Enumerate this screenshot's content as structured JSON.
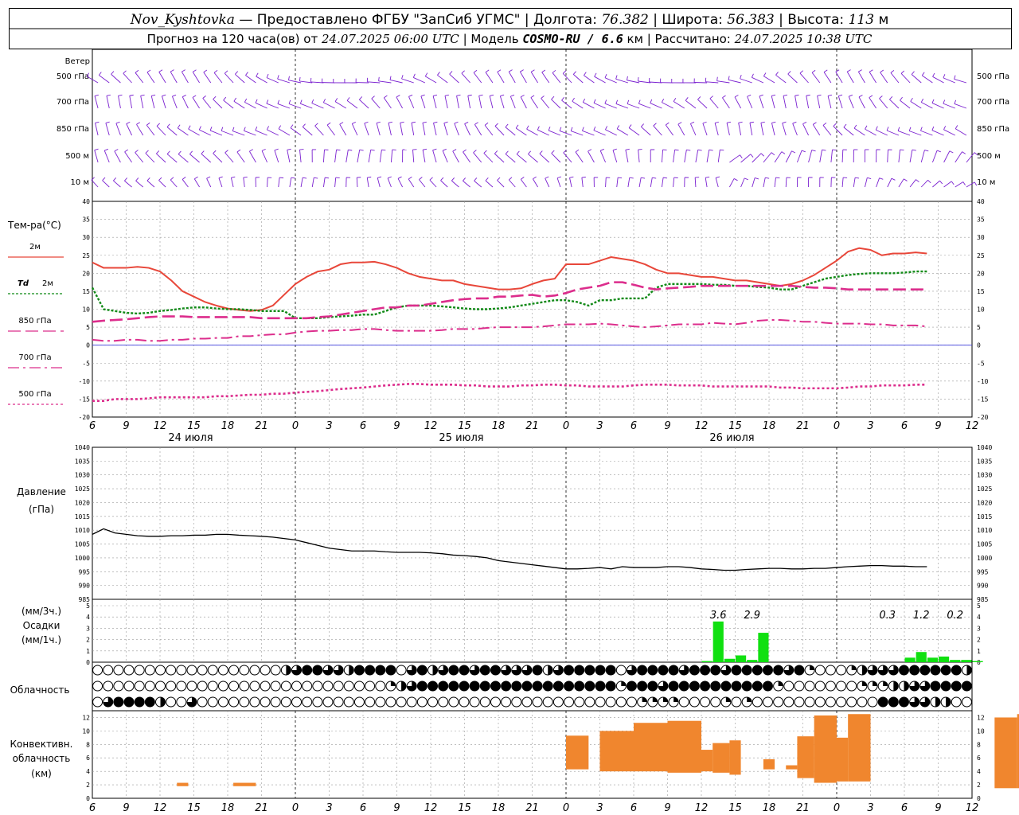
{
  "header": {
    "station": "Nov_Kyshtovka",
    "provider": " — Предоставлено ФГБУ \"ЗапСиб УГМС\"",
    "lon_label": "Долгота:",
    "lon_value": "76.382",
    "lat_label": "Широта:",
    "lat_value": "56.383",
    "alt_label": "Высота:",
    "alt_value": "113",
    "alt_unit": "м",
    "forecast_prefix": "Прогноз на 120 часа(ов) от",
    "forecast_date": "24.07.2025 06:00 UTC",
    "model_label": "Модель",
    "model_name": "COSMO-RU / 6.6",
    "model_unit": "км",
    "calc_label": "Рассчитано:",
    "calc_date": "24.07.2025 10:38 UTC"
  },
  "colors": {
    "wind": "#7a20d0",
    "t2m": "#e8473a",
    "td": "#128a18",
    "t850": "#dc2d8c",
    "t700": "#dc2d8c",
    "t500": "#dc2d8c",
    "zero": "#3a3adc",
    "precip": "#10e010",
    "conv": "#f0862e"
  },
  "chart_data": {
    "type": "line",
    "x_hours": {
      "start": "2025-07-24 06:00 UTC",
      "end": "2025-07-26 12:00 UTC",
      "tick_labels": [
        "6",
        "9",
        "12",
        "15",
        "18",
        "21",
        "0",
        "3",
        "6",
        "9",
        "12",
        "15",
        "18",
        "21",
        "0",
        "3",
        "6",
        "9",
        "12",
        "15",
        "18",
        "21",
        "0",
        "3",
        "6",
        "9",
        "12"
      ]
    },
    "day_labels": [
      "24 июля",
      "25 июля",
      "26 июля"
    ],
    "wind": {
      "title": "Ветер",
      "levels": [
        "500 гПа",
        "700 гПа",
        "850 гПа",
        "500 м",
        "10  м"
      ]
    },
    "temperature": {
      "title": "Тем-ра(°С)",
      "ylim": [
        -20,
        40
      ],
      "ticks": [
        "-20",
        "-15",
        "-10",
        "-5",
        "0",
        "5",
        "10",
        "15",
        "20",
        "25",
        "30",
        "35",
        "40"
      ],
      "legend": [
        {
          "label": "2м",
          "label_b": ""
        },
        {
          "label": "Td",
          "label_b": "2м"
        },
        {
          "label": "850 гПа",
          "label_b": ""
        },
        {
          "label": "700 гПа",
          "label_b": ""
        },
        {
          "label": "500 гПа",
          "label_b": ""
        }
      ],
      "series": [
        {
          "name": "2м",
          "values": [
            23,
            21.5,
            21.5,
            21.5,
            21.8,
            21.5,
            20.5,
            18,
            15,
            13.5,
            12,
            11,
            10.2,
            9.8,
            9.5,
            9.8,
            11,
            14,
            17,
            19,
            20.5,
            21,
            22.5,
            23,
            23,
            23.2,
            22.5,
            21.5,
            20,
            19,
            18.5,
            18,
            18,
            17,
            16.5,
            16,
            15.5,
            15.5,
            15.8,
            17,
            18,
            18.5,
            22.5,
            22.5,
            22.5,
            23.5,
            24.5,
            24,
            23.5,
            22.5,
            21,
            20,
            20,
            19.5,
            19,
            19,
            18.5,
            18,
            18,
            17.5,
            17,
            16.5,
            17,
            18,
            19.5,
            21.5,
            23.5,
            26,
            27,
            26.5,
            25,
            25.5,
            25.5,
            25.8,
            25.5
          ]
        },
        {
          "name": "Td 2м",
          "values": [
            16,
            10,
            9.5,
            9,
            8.8,
            9,
            9.5,
            9.8,
            10.2,
            10.5,
            10.5,
            10.2,
            10,
            10,
            9.8,
            9.5,
            9.5,
            9.5,
            7.5,
            7.5,
            7.5,
            7.8,
            8,
            8.2,
            8.5,
            8.5,
            9.5,
            10.5,
            11,
            11,
            11,
            10.8,
            10.5,
            10.2,
            10,
            10,
            10.2,
            10.5,
            11,
            11.5,
            12,
            12.5,
            12.5,
            12,
            11,
            12.5,
            12.5,
            13,
            13,
            13,
            16,
            17,
            17,
            17,
            17,
            16.8,
            16.8,
            16.5,
            16.5,
            16.2,
            16,
            15.5,
            15.5,
            16.5,
            17.5,
            18.5,
            19,
            19.5,
            19.8,
            20,
            20,
            20,
            20.2,
            20.5,
            20.5
          ]
        },
        {
          "name": "850 гПа",
          "values": [
            6.5,
            6.8,
            7,
            7.2,
            7.5,
            7.8,
            8,
            8,
            8,
            7.8,
            7.8,
            7.8,
            7.8,
            7.8,
            7.8,
            7.5,
            7.5,
            7.5,
            7.5,
            7.5,
            7.8,
            8,
            8.5,
            9,
            9.5,
            10,
            10.5,
            10.5,
            11,
            11,
            11.5,
            12,
            12.5,
            12.8,
            13,
            13,
            13.5,
            13.5,
            13.8,
            14,
            13.5,
            13.8,
            14.5,
            15.5,
            16,
            16.5,
            17.5,
            17.5,
            16.8,
            16,
            15.5,
            15.8,
            16,
            16.2,
            16.5,
            16.5,
            16.5,
            16.5,
            16.5,
            16.5,
            16.5,
            16.5,
            16.5,
            16.2,
            16,
            16,
            15.8,
            15.5,
            15.5,
            15.5,
            15.5,
            15.5,
            15.5,
            15.5,
            15.5
          ]
        },
        {
          "name": "700 гПа",
          "values": [
            1.5,
            1.2,
            1.2,
            1.5,
            1.5,
            1.2,
            1.2,
            1.5,
            1.5,
            1.8,
            1.8,
            2,
            2,
            2.5,
            2.5,
            2.8,
            3,
            3,
            3.5,
            3.8,
            4,
            4,
            4.2,
            4.2,
            4.5,
            4.5,
            4.2,
            4,
            4,
            4,
            4,
            4.2,
            4.5,
            4.5,
            4.5,
            4.8,
            5,
            5,
            5,
            5,
            5.2,
            5.5,
            5.8,
            5.8,
            5.8,
            6,
            5.8,
            5.5,
            5.2,
            5,
            5.2,
            5.5,
            5.8,
            5.8,
            5.8,
            6.2,
            6,
            5.8,
            6.2,
            6.8,
            7,
            7,
            6.8,
            6.5,
            6.5,
            6.2,
            6,
            6,
            6,
            5.8,
            5.8,
            5.5,
            5.5,
            5.5,
            5.2
          ]
        },
        {
          "name": "500 гПа",
          "values": [
            -15.5,
            -15.5,
            -15,
            -15,
            -15,
            -14.8,
            -14.5,
            -14.5,
            -14.5,
            -14.5,
            -14.5,
            -14.2,
            -14.2,
            -14,
            -13.8,
            -13.8,
            -13.5,
            -13.5,
            -13.2,
            -13,
            -12.8,
            -12.5,
            -12.2,
            -12,
            -11.8,
            -11.5,
            -11.2,
            -11,
            -10.8,
            -10.8,
            -11,
            -11,
            -11,
            -11.2,
            -11.2,
            -11.5,
            -11.5,
            -11.5,
            -11.2,
            -11.2,
            -11,
            -11,
            -11.2,
            -11.2,
            -11.5,
            -11.5,
            -11.5,
            -11.5,
            -11.2,
            -11,
            -11,
            -11,
            -11.2,
            -11.2,
            -11.2,
            -11.5,
            -11.5,
            -11.5,
            -11.5,
            -11.5,
            -11.5,
            -11.8,
            -11.8,
            -12,
            -12,
            -12,
            -12,
            -11.8,
            -11.5,
            -11.5,
            -11.2,
            -11.2,
            -11.2,
            -11,
            -11
          ]
        }
      ]
    },
    "pressure": {
      "title_a": "Давление",
      "title_b": "(гПа)",
      "ylim": [
        985,
        1040
      ],
      "ticks": [
        "985",
        "990",
        "995",
        "1000",
        "1005",
        "1010",
        "1015",
        "1020",
        "1025",
        "1030",
        "1035",
        "1040"
      ],
      "values": [
        1008.5,
        1010.5,
        1009,
        1008.5,
        1008,
        1007.8,
        1007.8,
        1008,
        1008,
        1008.2,
        1008.2,
        1008.5,
        1008.5,
        1008.2,
        1008,
        1007.8,
        1007.5,
        1007,
        1006.5,
        1005.5,
        1004.5,
        1003.5,
        1003,
        1002.5,
        1002.5,
        1002.5,
        1002.2,
        1002,
        1002,
        1002,
        1001.8,
        1001.5,
        1001,
        1000.8,
        1000.5,
        1000,
        999,
        998.5,
        998,
        997.5,
        997,
        996.5,
        996,
        996,
        996.2,
        996.5,
        996,
        996.8,
        996.5,
        996.5,
        996.5,
        996.8,
        996.8,
        996.5,
        996,
        995.8,
        995.5,
        995.5,
        995.8,
        996,
        996.2,
        996.2,
        996,
        996,
        996.2,
        996.2,
        996.5,
        996.8,
        997,
        997.2,
        997.2,
        997,
        997,
        996.8,
        996.8
      ]
    },
    "precip": {
      "title_a": "(мм/3ч.)",
      "title_b": "Осадки",
      "title_c": "(мм/1ч.)",
      "ylim": [
        0,
        5
      ],
      "ticks": [
        "0",
        "1",
        "2",
        "3",
        "4",
        "5"
      ],
      "hourly": [
        {
          "h": 54,
          "v": 0.1
        },
        {
          "h": 55,
          "v": 3.6
        },
        {
          "h": 56,
          "v": 0.3
        },
        {
          "h": 57,
          "v": 0.6
        },
        {
          "h": 58,
          "v": 0.2
        },
        {
          "h": 59,
          "v": 2.6
        },
        {
          "h": 72,
          "v": 0.4
        },
        {
          "h": 73,
          "v": 0.9
        },
        {
          "h": 74,
          "v": 0.4
        },
        {
          "h": 75,
          "v": 0.5
        },
        {
          "h": 76,
          "v": 0.2
        },
        {
          "h": 77,
          "v": 0.2
        },
        {
          "h": 78,
          "v": 0.1
        }
      ],
      "totals": [
        {
          "h": 55.5,
          "label": "3.6"
        },
        {
          "h": 58.5,
          "label": "2.9"
        },
        {
          "h": 70.5,
          "label": "0.3"
        },
        {
          "h": 73.5,
          "label": "1.2"
        },
        {
          "h": 76.5,
          "label": "0.2"
        }
      ]
    },
    "cloud": {
      "title": "Облачность",
      "rows": [
        "000000000000000000234433244440342344344333423444440344443444344444341000123334444442",
        "000000000000000000000000000012344444444444444444441444344444444441000000011122334444",
        "034444200300000000000000000000000000000000000000000011110000101000000000000444332200"
      ]
    },
    "convection": {
      "title_a": "Конвективн.",
      "title_b": "облачность",
      "title_c": "(км)",
      "ylim": [
        0,
        13
      ],
      "ticks": [
        "0",
        "2",
        "4",
        "6",
        "8",
        "10",
        "12"
      ],
      "bars": [
        {
          "h0": 7.5,
          "h1": 8.5,
          "base": 1.8,
          "top": 2.3
        },
        {
          "h0": 12.5,
          "h1": 14.5,
          "base": 1.8,
          "top": 2.3
        },
        {
          "h0": 42,
          "h1": 44,
          "base": 4.3,
          "top": 9.3
        },
        {
          "h0": 45,
          "h1": 48,
          "base": 4.0,
          "top": 10.0
        },
        {
          "h0": 48,
          "h1": 51,
          "base": 4.0,
          "top": 11.2
        },
        {
          "h0": 51,
          "h1": 54,
          "base": 3.8,
          "top": 11.5
        },
        {
          "h0": 54,
          "h1": 55,
          "base": 4.0,
          "top": 7.2
        },
        {
          "h0": 55,
          "h1": 56.5,
          "base": 3.8,
          "top": 8.2
        },
        {
          "h0": 56.5,
          "h1": 57.5,
          "base": 3.5,
          "top": 8.6
        },
        {
          "h0": 59.5,
          "h1": 60.5,
          "base": 4.3,
          "top": 5.8
        },
        {
          "h0": 61.5,
          "h1": 62.5,
          "base": 4.3,
          "top": 4.9
        },
        {
          "h0": 62.5,
          "h1": 64,
          "base": 3.0,
          "top": 9.2
        },
        {
          "h0": 64,
          "h1": 66,
          "base": 2.3,
          "top": 12.3
        },
        {
          "h0": 66,
          "h1": 67,
          "base": 2.5,
          "top": 9.0
        },
        {
          "h0": 67,
          "h1": 69,
          "base": 2.5,
          "top": 12.5
        },
        {
          "h0": 80,
          "h1": 82,
          "base": 1.5,
          "top": 12.0
        },
        {
          "h0": 82,
          "h1": 84,
          "base": 1.5,
          "top": 12.5
        },
        {
          "h0": 84,
          "h1": 86,
          "base": 1.8,
          "top": 12.5
        },
        {
          "h0": 86,
          "h1": 87.5,
          "base": 1.5,
          "top": 12.5
        },
        {
          "h0": 87.5,
          "h1": 89,
          "base": 1.2,
          "top": 12.5
        },
        {
          "h0": 89,
          "h1": 90,
          "base": 1.5,
          "top": 12.5
        }
      ]
    }
  }
}
